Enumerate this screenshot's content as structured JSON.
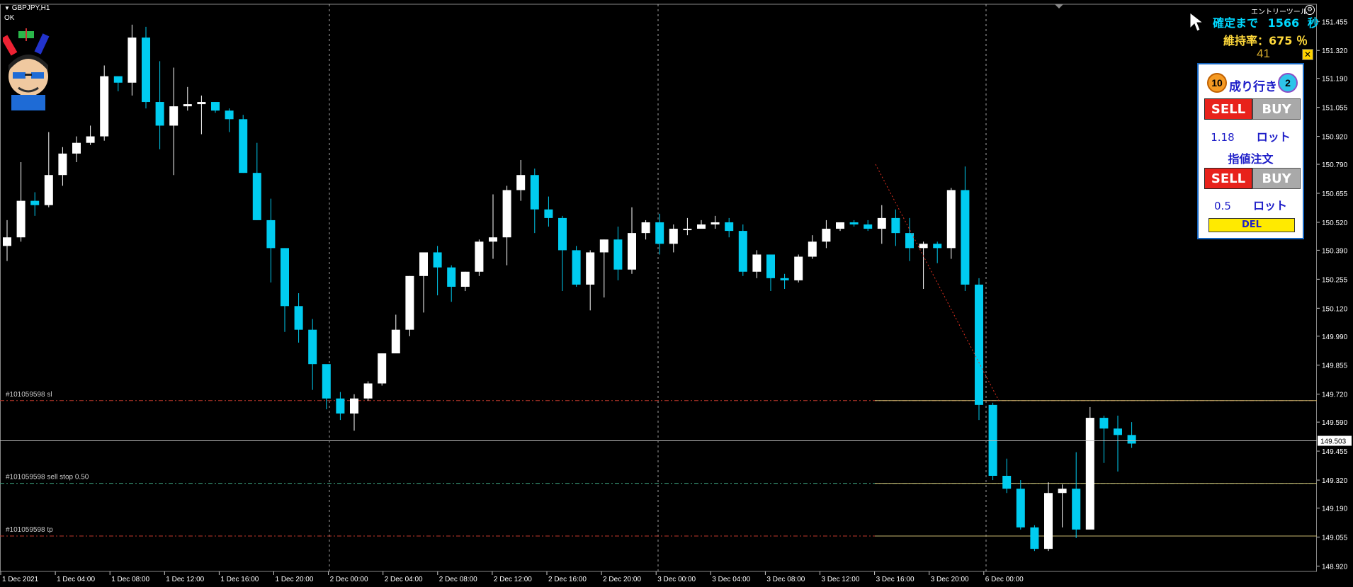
{
  "header": {
    "symbol_timeframe": "GBPJPY,H1",
    "status": "OK"
  },
  "tool": {
    "name": "エントリーツール",
    "countdown_label": "確定まで",
    "countdown_value": "1566",
    "countdown_unit": "秒",
    "margin_label": "維持率：675 ％",
    "counter": "41",
    "close_glyph": "✕"
  },
  "panel": {
    "market_label": "成り行き",
    "left_count": "10",
    "right_count": "2",
    "sell_label": "SELL",
    "buy_label": "BUY",
    "lot_value": "1.18",
    "lot_unit": "ロット",
    "limit_label": "指値注文",
    "sell2_label": "SELL",
    "buy2_label": "BUY",
    "lot2_value": "0.5",
    "lot2_unit": "ロット",
    "del_label": "DEL"
  },
  "orders": [
    {
      "label": "#101059598 sl",
      "price": 149.69,
      "color": "#c0392b"
    },
    {
      "label": "#101059598 sell stop 0.50",
      "price": 149.305,
      "color": "#3a9a7a"
    },
    {
      "label": "#101059598 tp",
      "price": 149.06,
      "color": "#c0392b"
    }
  ],
  "current_price": "149.503",
  "colors": {
    "bull": "#ffffff",
    "bear": "#00ccf0",
    "grid": "#c8c8c8",
    "axis_text": "#ffffff",
    "target_line": "#c8b870"
  },
  "chart_data": {
    "type": "candlestick",
    "y_ticks": [
      "151.455",
      "151.320",
      "151.190",
      "151.055",
      "150.920",
      "150.790",
      "150.655",
      "150.520",
      "150.390",
      "150.255",
      "150.120",
      "149.990",
      "149.855",
      "149.720",
      "149.590",
      "149.455",
      "149.320",
      "149.190",
      "149.055",
      "148.920"
    ],
    "ylim": [
      148.895,
      151.535
    ],
    "x_labels": [
      "1 Dec 2021",
      "1 Dec 04:00",
      "1 Dec 08:00",
      "1 Dec 12:00",
      "1 Dec 16:00",
      "1 Dec 20:00",
      "2 Dec 00:00",
      "2 Dec 04:00",
      "2 Dec 08:00",
      "2 Dec 12:00",
      "2 Dec 16:00",
      "2 Dec 20:00",
      "3 Dec 00:00",
      "3 Dec 04:00",
      "3 Dec 08:00",
      "3 Dec 12:00",
      "3 Dec 16:00",
      "3 Dec 20:00",
      "6 Dec 00:00"
    ],
    "candles": [
      [
        150.41,
        150.45,
        150.34,
        150.53
      ],
      [
        150.45,
        150.62,
        150.43,
        150.8
      ],
      [
        150.62,
        150.6,
        150.55,
        150.66
      ],
      [
        150.6,
        150.74,
        150.59,
        150.94
      ],
      [
        150.74,
        150.84,
        150.69,
        150.87
      ],
      [
        150.84,
        150.89,
        150.8,
        150.92
      ],
      [
        150.89,
        150.92,
        150.88,
        150.97
      ],
      [
        150.92,
        151.2,
        150.9,
        151.25
      ],
      [
        151.2,
        151.17,
        151.13,
        151.19
      ],
      [
        151.17,
        151.38,
        151.11,
        151.44
      ],
      [
        151.38,
        151.08,
        151.05,
        151.43
      ],
      [
        151.08,
        150.97,
        150.86,
        151.27
      ],
      [
        150.97,
        151.06,
        150.74,
        151.24
      ],
      [
        151.06,
        151.07,
        151.04,
        151.15
      ],
      [
        151.07,
        151.08,
        150.93,
        151.11
      ],
      [
        151.08,
        151.04,
        151.03,
        151.08
      ],
      [
        151.04,
        151.0,
        150.94,
        151.05
      ],
      [
        151.0,
        150.75,
        150.75,
        151.02
      ],
      [
        150.75,
        150.53,
        150.53,
        150.89
      ],
      [
        150.53,
        150.4,
        150.24,
        150.63
      ],
      [
        150.4,
        150.13,
        150.01,
        150.4
      ],
      [
        150.13,
        150.02,
        149.96,
        150.19
      ],
      [
        150.02,
        149.86,
        149.74,
        150.07
      ],
      [
        149.86,
        149.7,
        149.65,
        149.85
      ],
      [
        149.7,
        149.63,
        149.6,
        149.73
      ],
      [
        149.63,
        149.7,
        149.55,
        149.72
      ],
      [
        149.7,
        149.77,
        149.69,
        149.78
      ],
      [
        149.77,
        149.91,
        149.76,
        149.91
      ],
      [
        149.91,
        150.02,
        149.92,
        150.09
      ],
      [
        150.02,
        150.27,
        149.99,
        150.27
      ],
      [
        150.27,
        150.38,
        150.1,
        150.38
      ],
      [
        150.38,
        150.31,
        150.18,
        150.41
      ],
      [
        150.31,
        150.22,
        150.15,
        150.32
      ],
      [
        150.22,
        150.29,
        150.2,
        150.29
      ],
      [
        150.29,
        150.43,
        150.27,
        150.44
      ],
      [
        150.43,
        150.45,
        150.35,
        150.65
      ],
      [
        150.45,
        150.67,
        150.32,
        150.69
      ],
      [
        150.67,
        150.74,
        150.62,
        150.81
      ],
      [
        150.74,
        150.58,
        150.47,
        150.77
      ],
      [
        150.58,
        150.54,
        150.5,
        150.64
      ],
      [
        150.54,
        150.39,
        150.2,
        150.55
      ],
      [
        150.39,
        150.23,
        150.22,
        150.41
      ],
      [
        150.23,
        150.38,
        150.11,
        150.39
      ],
      [
        150.38,
        150.44,
        150.17,
        150.44
      ],
      [
        150.44,
        150.3,
        150.25,
        150.5
      ],
      [
        150.3,
        150.47,
        150.28,
        150.59
      ],
      [
        150.47,
        150.52,
        150.44,
        150.53
      ],
      [
        150.52,
        150.42,
        150.37,
        150.56
      ],
      [
        150.42,
        150.49,
        150.38,
        150.51
      ],
      [
        150.49,
        150.49,
        150.46,
        150.54
      ],
      [
        150.49,
        150.51,
        150.5,
        150.53
      ],
      [
        150.51,
        150.52,
        150.49,
        150.55
      ],
      [
        150.52,
        150.48,
        150.45,
        150.54
      ],
      [
        150.48,
        150.29,
        150.27,
        150.51
      ],
      [
        150.29,
        150.37,
        150.26,
        150.39
      ],
      [
        150.37,
        150.26,
        150.2,
        150.37
      ],
      [
        150.26,
        150.25,
        150.21,
        150.28
      ],
      [
        150.25,
        150.36,
        150.24,
        150.37
      ],
      [
        150.36,
        150.43,
        150.35,
        150.46
      ],
      [
        150.43,
        150.49,
        150.4,
        150.53
      ],
      [
        150.49,
        150.52,
        150.48,
        150.51
      ],
      [
        150.52,
        150.51,
        150.5,
        150.53
      ],
      [
        150.51,
        150.49,
        150.48,
        150.53
      ],
      [
        150.49,
        150.54,
        150.42,
        150.6
      ],
      [
        150.54,
        150.47,
        150.41,
        150.58
      ],
      [
        150.47,
        150.4,
        150.34,
        150.54
      ],
      [
        150.4,
        150.42,
        150.21,
        150.43
      ],
      [
        150.42,
        150.4,
        150.33,
        150.43
      ],
      [
        150.4,
        150.67,
        150.35,
        150.68
      ],
      [
        150.67,
        150.23,
        150.2,
        150.78
      ],
      [
        150.23,
        149.67,
        149.6,
        150.26
      ],
      [
        149.67,
        149.34,
        149.32,
        149.68
      ],
      [
        149.34,
        149.28,
        149.26,
        149.42
      ],
      [
        149.28,
        149.1,
        149.09,
        149.32
      ],
      [
        149.1,
        149.0,
        148.99,
        149.11
      ],
      [
        149.0,
        149.26,
        148.99,
        149.31
      ],
      [
        149.26,
        149.28,
        149.1,
        149.3
      ],
      [
        149.28,
        149.09,
        149.05,
        149.45
      ],
      [
        149.09,
        149.61,
        149.4,
        149.66
      ],
      [
        149.61,
        149.56,
        149.4,
        149.62
      ],
      [
        149.56,
        149.53,
        149.36,
        149.62
      ],
      [
        149.53,
        149.49,
        149.47,
        149.59
      ]
    ]
  }
}
